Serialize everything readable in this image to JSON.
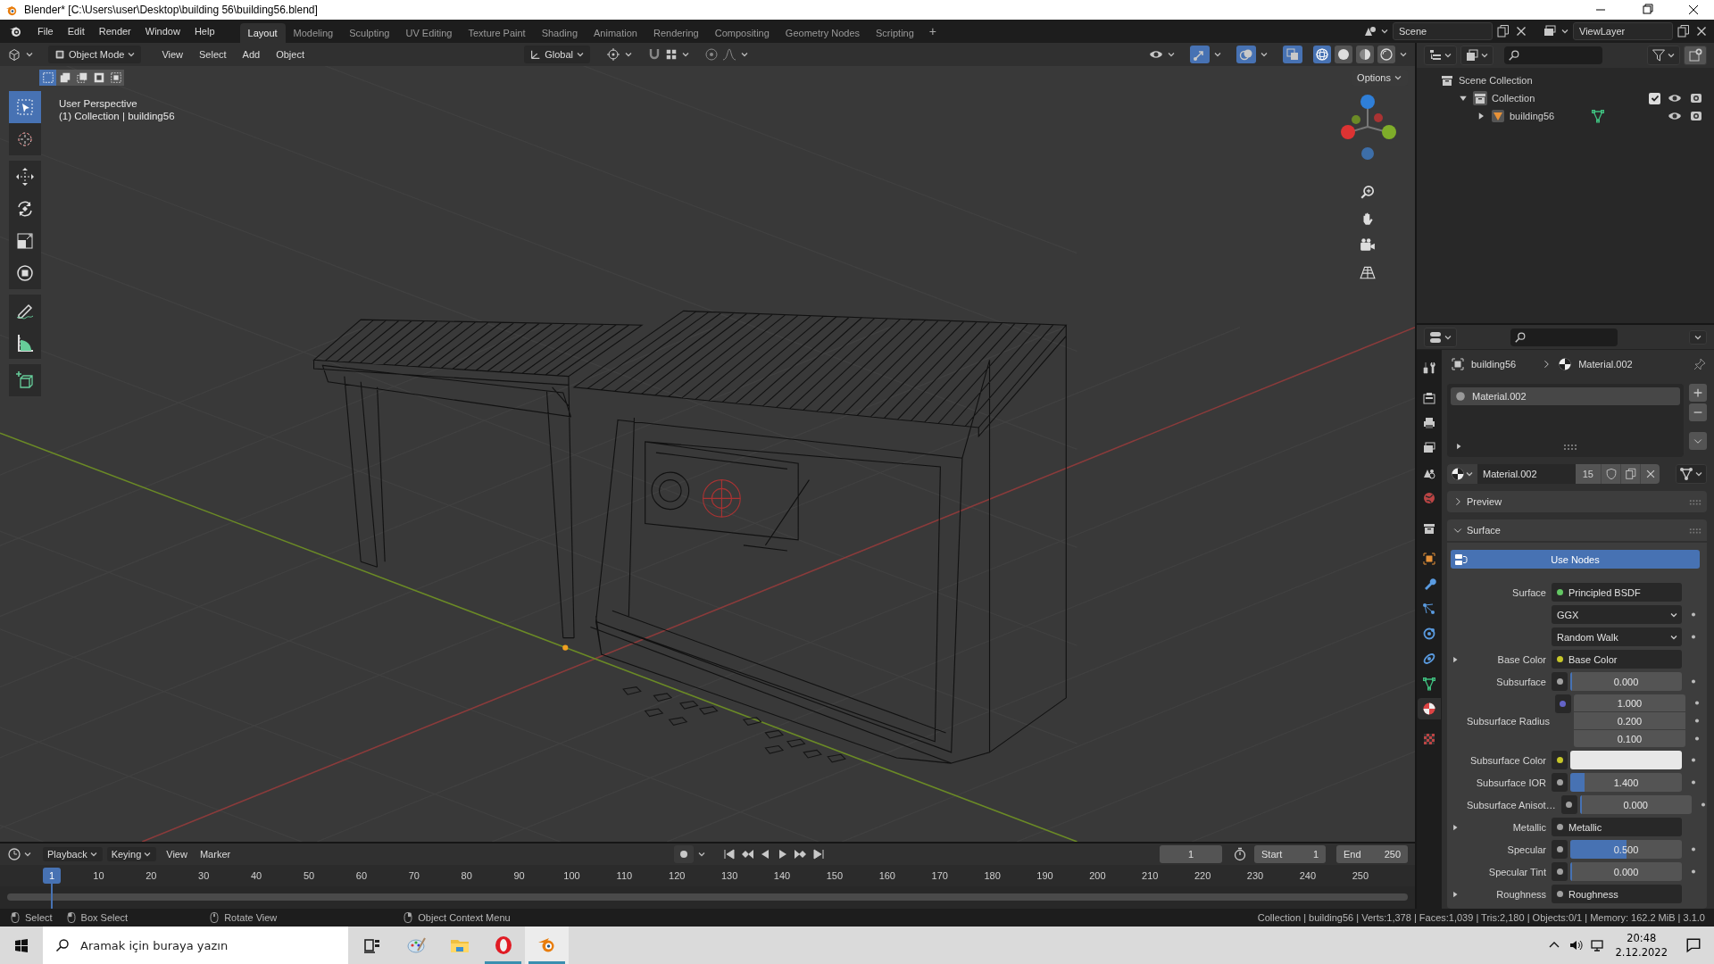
{
  "window": {
    "title": "Blender* [C:\\Users\\user\\Desktop\\building 56\\building56.blend]"
  },
  "menu": [
    "File",
    "Edit",
    "Render",
    "Window",
    "Help"
  ],
  "workspaces": [
    {
      "label": "Layout",
      "selected": true
    },
    {
      "label": "Modeling",
      "selected": false
    },
    {
      "label": "Sculpting",
      "selected": false
    },
    {
      "label": "UV Editing",
      "selected": false
    },
    {
      "label": "Texture Paint",
      "selected": false
    },
    {
      "label": "Shading",
      "selected": false
    },
    {
      "label": "Animation",
      "selected": false
    },
    {
      "label": "Rendering",
      "selected": false
    },
    {
      "label": "Compositing",
      "selected": false
    },
    {
      "label": "Geometry Nodes",
      "selected": false
    },
    {
      "label": "Scripting",
      "selected": false
    }
  ],
  "add_workspace": "+",
  "scene": "Scene",
  "view_layer": "ViewLayer",
  "viewport": {
    "mode": "Object Mode",
    "menus": [
      "View",
      "Select",
      "Add",
      "Object"
    ],
    "orientation": "Global",
    "shading": [
      {
        "kind": "wireframe",
        "selected": true
      },
      {
        "kind": "solid",
        "selected": false
      },
      {
        "kind": "material",
        "selected": false
      },
      {
        "kind": "rendered",
        "selected": false
      }
    ],
    "select_modes": [
      {
        "kind": "new",
        "selected": true
      },
      {
        "kind": "extend",
        "selected": false
      },
      {
        "kind": "subtract",
        "selected": false
      },
      {
        "kind": "invert",
        "selected": false
      },
      {
        "kind": "intersect",
        "selected": false
      }
    ],
    "options": "Options",
    "info": [
      "User Perspective",
      "(1) Collection | building56"
    ],
    "tools": [
      {
        "kind": "select",
        "selected": true
      },
      {
        "kind": "cursor",
        "selected": false
      },
      {
        "kind": "move",
        "selected": false
      },
      {
        "kind": "rotate",
        "selected": false
      },
      {
        "kind": "scale",
        "selected": false
      },
      {
        "kind": "transform",
        "selected": false
      },
      {
        "kind": "annotate",
        "selected": false
      },
      {
        "kind": "measure",
        "selected": false
      },
      {
        "kind": "add_cube",
        "selected": false
      }
    ]
  },
  "outliner": {
    "tree": [
      {
        "kind": "scene_collection",
        "label": "Scene Collection",
        "children": [
          {
            "kind": "collection",
            "label": "Collection",
            "expanded": true,
            "checked": true,
            "children": [
              {
                "kind": "object",
                "label": "building56",
                "expanded": false
              }
            ]
          }
        ]
      }
    ]
  },
  "properties": {
    "tabs": [
      {
        "kind": "tool",
        "selected": false
      },
      {
        "kind": "render",
        "selected": false
      },
      {
        "kind": "output",
        "selected": false
      },
      {
        "kind": "view_layer",
        "selected": false
      },
      {
        "kind": "scene",
        "selected": false
      },
      {
        "kind": "world",
        "selected": false
      },
      {
        "kind": "collection",
        "selected": false
      },
      {
        "kind": "object",
        "selected": false
      },
      {
        "kind": "modifiers",
        "selected": false
      },
      {
        "kind": "particles",
        "selected": false
      },
      {
        "kind": "physics",
        "selected": false
      },
      {
        "kind": "constraints",
        "selected": false
      },
      {
        "kind": "data",
        "selected": false
      },
      {
        "kind": "material",
        "selected": true
      },
      {
        "kind": "texture",
        "selected": false
      }
    ],
    "breadcrumb": [
      "building56",
      "Material.002"
    ],
    "slots": [
      {
        "label": "Material.002",
        "selected": true
      }
    ],
    "material": {
      "name": "Material.002",
      "users": "15"
    },
    "panels": [
      {
        "label": "Preview",
        "expanded": false
      },
      {
        "label": "Surface",
        "expanded": true
      }
    ],
    "use_nodes": {
      "label": "Use Nodes",
      "on": true
    },
    "rows": [
      {
        "kind": "socket",
        "label": "Surface",
        "value": "Principled BSDF",
        "color": "#63c763"
      },
      {
        "kind": "dropdown",
        "value": "GGX"
      },
      {
        "kind": "dropdown",
        "value": "Random Walk"
      },
      {
        "kind": "socket",
        "label": "Base Color",
        "value": "Base Color",
        "color": "#c7c729",
        "expandable": true
      },
      {
        "kind": "number",
        "label": "Subsurface",
        "value": "0.000",
        "level": 0,
        "color": "#a1a1a1"
      },
      {
        "kind": "vector",
        "label": "Subsurface Radius",
        "values": [
          "1.000",
          "0.200",
          "0.100"
        ],
        "color": "#6363c7"
      },
      {
        "kind": "color",
        "label": "Subsurface Color",
        "color": "#c7c729"
      },
      {
        "kind": "number",
        "label": "Subsurface IOR",
        "value": "1.400",
        "level": 0.13,
        "color": "#a1a1a1"
      },
      {
        "kind": "number",
        "label": "Subsurface Anisot…",
        "value": "0.000",
        "level": 0,
        "color": "#a1a1a1"
      },
      {
        "kind": "socket",
        "label": "Metallic",
        "value": "Metallic",
        "color": "#a1a1a1",
        "expandable": true
      },
      {
        "kind": "number",
        "label": "Specular",
        "value": "0.500",
        "level": 0.5,
        "color": "#a1a1a1"
      },
      {
        "kind": "number",
        "label": "Specular Tint",
        "value": "0.000",
        "level": 0,
        "color": "#a1a1a1"
      },
      {
        "kind": "socket",
        "label": "Roughness",
        "value": "Roughness",
        "color": "#a1a1a1",
        "expandable": true
      }
    ]
  },
  "timeline": {
    "menus": [
      {
        "label": "Playback",
        "dropdown": true
      },
      {
        "label": "Keying",
        "dropdown": true
      },
      {
        "label": "View",
        "dropdown": false
      },
      {
        "label": "Marker",
        "dropdown": false
      }
    ],
    "current_frame": "1",
    "start_label": "Start",
    "start": "1",
    "end_label": "End",
    "end": "250",
    "playhead": "1",
    "ticks": [
      "10",
      "20",
      "30",
      "40",
      "50",
      "60",
      "70",
      "80",
      "90",
      "100",
      "110",
      "120",
      "130",
      "140",
      "150",
      "160",
      "170",
      "180",
      "190",
      "200",
      "210",
      "220",
      "230",
      "240",
      "250"
    ]
  },
  "status_bar": {
    "hints": [
      "Select",
      "Box Select",
      "Rotate View",
      "Object Context Menu"
    ],
    "stats": "Collection | building56 | Verts:1,378 | Faces:1,039 | Tris:2,180 | Objects:0/1 | Memory: 162.2 MiB | 3.1.0"
  },
  "taskbar": {
    "search": {
      "placeholder": "Aramak için buraya yazın"
    },
    "apps": [
      {
        "kind": "task_view",
        "running": false,
        "selected": false
      },
      {
        "kind": "paint",
        "running": false,
        "selected": false
      },
      {
        "kind": "explorer",
        "running": false,
        "selected": false
      },
      {
        "kind": "opera",
        "running": true,
        "selected": false
      },
      {
        "kind": "blender",
        "running": true,
        "selected": true
      }
    ],
    "time": "20:48",
    "date": "2.12.2022"
  }
}
